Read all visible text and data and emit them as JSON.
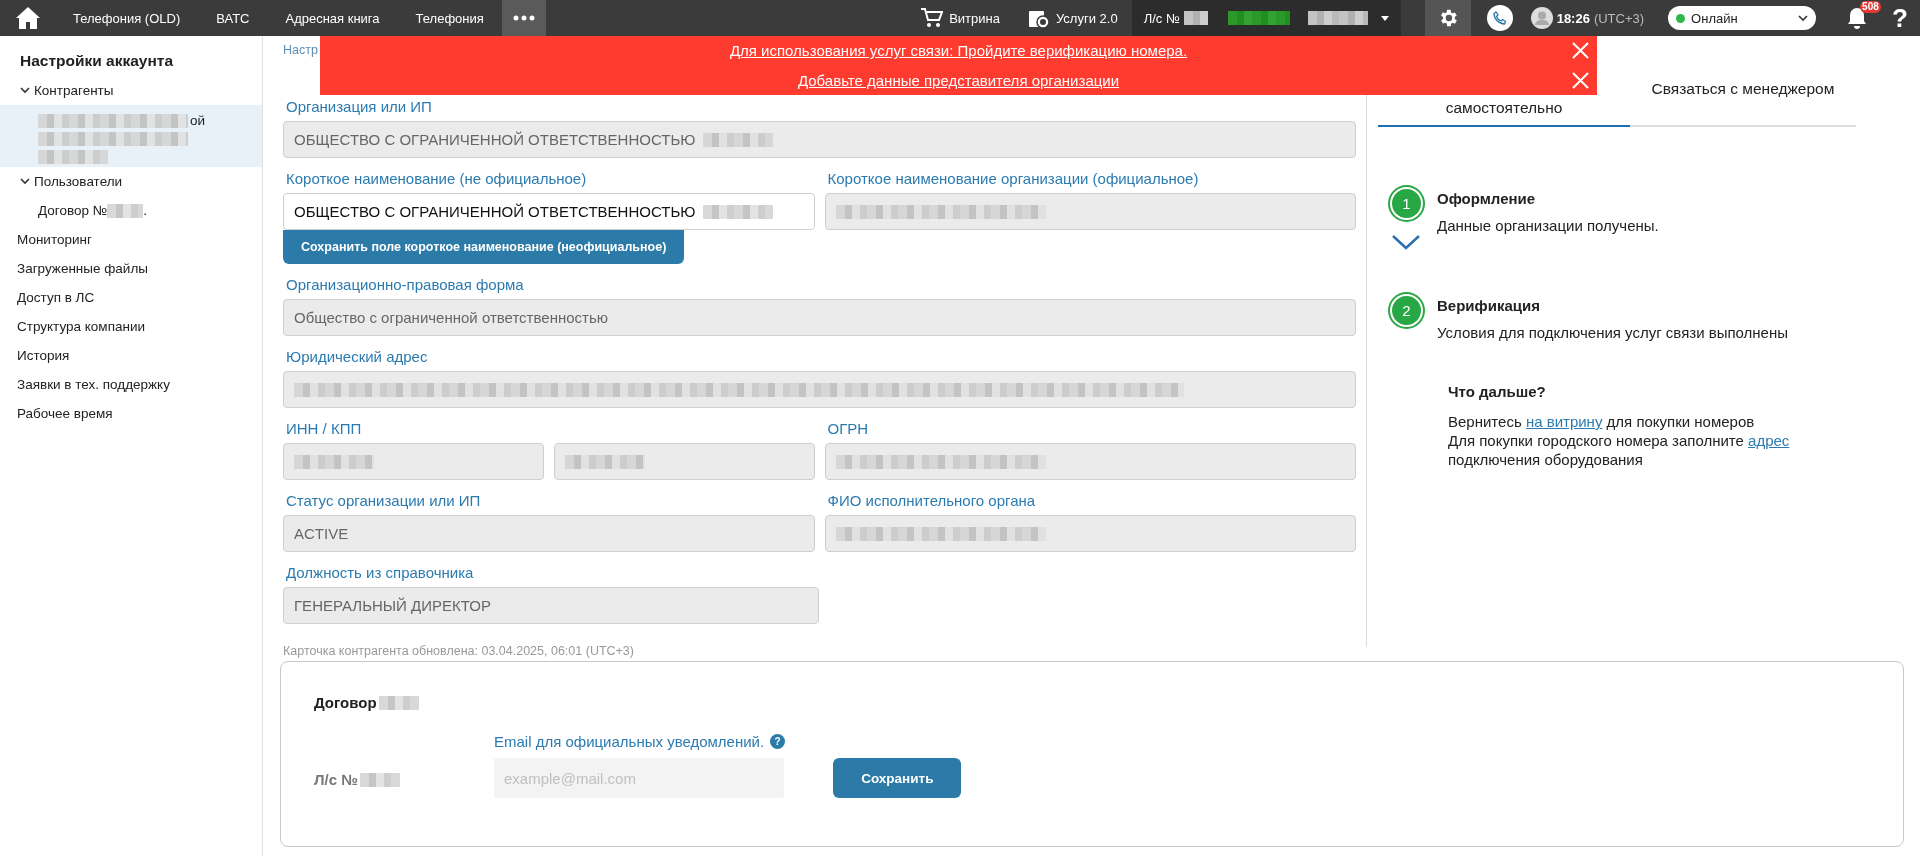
{
  "topbar": {
    "nav": [
      {
        "label": "Телефония (OLD)"
      },
      {
        "label": "ВАТС"
      },
      {
        "label": "Адресная книга"
      },
      {
        "label": "Телефония"
      }
    ],
    "shop": "Витрина",
    "services": "Услуги 2.0",
    "account": "Л/с №",
    "time": "18:26",
    "timezone": "(UTC+3)",
    "status": {
      "label": "Онлайн",
      "color": "#2db84c"
    },
    "notifications": "508",
    "help": "?"
  },
  "sidebar": {
    "title": "Настройки аккаунта",
    "items": [
      {
        "label": "Контрагенты",
        "expanded": true,
        "children": [
          {
            "label": "ой",
            "redacted": true,
            "selected": true
          }
        ]
      },
      {
        "label": "Пользователи",
        "expanded": true,
        "children": [
          {
            "label": "Договор №",
            "suffix": ".",
            "redacted": true,
            "selected": false
          }
        ]
      },
      {
        "label": "Мониторинг",
        "selected": false
      },
      {
        "label": "Загруженные файлы",
        "selected": false
      },
      {
        "label": "Доступ в ЛС",
        "selected": false
      },
      {
        "label": "Структура компании",
        "selected": false
      },
      {
        "label": "История",
        "selected": false
      },
      {
        "label": "Заявки в тех. поддержку",
        "selected": false
      },
      {
        "label": "Рабочее время",
        "selected": false
      }
    ]
  },
  "banner": {
    "messages": [
      {
        "text": "Для использования услуг связи: Пройдите верификацию номера."
      },
      {
        "text": "Добавьте данные представителя организации"
      }
    ]
  },
  "form": {
    "breadcrumb": "Настр",
    "rows": [
      [
        {
          "label": "Организация или ИП",
          "fields": [
            {
              "value": "ОБЩЕСТВО С ОГРАНИЧЕННОЙ ОТВЕТСТВЕННОСТЬЮ",
              "redacted": true,
              "editable": false
            }
          ]
        }
      ],
      [
        {
          "label": "Короткое наименование (не официальное)",
          "fields": [
            {
              "value": "ОБЩЕСТВО С ОГРАНИЧЕННОЙ ОТВЕТСТВЕННОСТЬЮ",
              "redacted": true,
              "editable": true
            }
          ],
          "button": "Сохранить поле короткое наименование (неофициальное)"
        },
        {
          "label": "Короткое наименование организации (официальное)",
          "fields": [
            {
              "redacted": true,
              "editable": false
            }
          ]
        }
      ],
      [
        {
          "label": "Организационно-правовая форма",
          "fields": [
            {
              "value": "Общество с ограниченной ответственностью",
              "redacted": false,
              "editable": false
            }
          ]
        }
      ],
      [
        {
          "label": "Юридический адрес",
          "fields": [
            {
              "redacted": true,
              "editable": false
            }
          ]
        }
      ],
      [
        {
          "label": "ИНН / КПП",
          "fields": [
            {
              "redacted": true,
              "editable": false
            },
            {
              "redacted": true,
              "editable": false
            }
          ]
        },
        {
          "label": "ОГРН",
          "fields": [
            {
              "redacted": true,
              "editable": false
            }
          ]
        }
      ],
      [
        {
          "label": "Статус организации или ИП",
          "fields": [
            {
              "value": "ACTIVE",
              "redacted": false,
              "editable": false
            }
          ]
        },
        {
          "label": "ФИО исполнительного органа",
          "fields": [
            {
              "redacted": true,
              "editable": false
            }
          ]
        }
      ],
      [
        {
          "label": "Должность из справочника",
          "fields": [
            {
              "value": "ГЕНЕРАЛЬНЫЙ ДИРЕКТОР",
              "redacted": false,
              "editable": false
            }
          ]
        }
      ]
    ],
    "updated": "Карточка контрагента обновлена: 03.04.2025, 06:01 (UTC+3)"
  },
  "right_panel": {
    "tabs": [
      {
        "label": "самостоятельно",
        "selected": true
      },
      {
        "label": "Связаться с менеджером",
        "selected": false
      }
    ],
    "steps": [
      {
        "number": "1",
        "title": "Оформление",
        "text": "Данные организации получены."
      },
      {
        "number": "2",
        "title": "Верификация",
        "text": "Условия для подключения услуг связи выполнены"
      }
    ],
    "next_title": "Что дальше?",
    "paragraphs": [
      [
        {
          "text": "Вернитесь ",
          "link": false
        },
        {
          "text": "на витрину",
          "link": true
        },
        {
          "text": " для покупки номеров",
          "link": false
        }
      ],
      [
        {
          "text": "Для покупки городского номера заполните ",
          "link": false
        },
        {
          "text": "адрес",
          "link": true
        },
        {
          "text": " подключения оборудования",
          "link": false
        }
      ]
    ]
  },
  "contract": {
    "title": "Договор",
    "account": "Л/с №",
    "email_label": "Email для официальных уведомлений.",
    "help": "?",
    "placeholder": "example@mail.com",
    "button": "Сохранить"
  }
}
